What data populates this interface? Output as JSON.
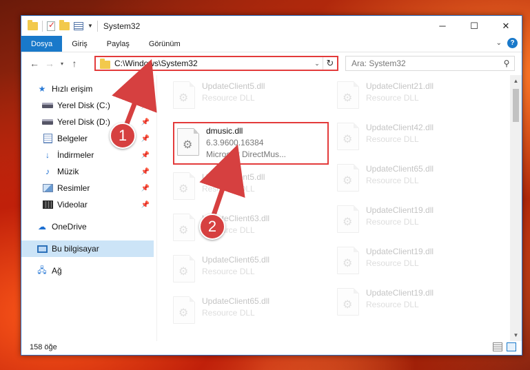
{
  "window": {
    "title": "System32",
    "controls": {
      "minimize": "─",
      "maximize": "☐",
      "close": "✕"
    }
  },
  "ribbon": {
    "tabs": [
      "Dosya",
      "Giriş",
      "Paylaş",
      "Görünüm"
    ],
    "help": "?"
  },
  "navigation": {
    "back": "←",
    "forward": "→",
    "recent": "▾",
    "up": "↑",
    "address": "C:\\Windows\\System32",
    "search_placeholder": "Ara: System32"
  },
  "sidebar": {
    "quick_access": "Hızlı erişim",
    "pinned": [
      {
        "label": "Yerel Disk (C:)",
        "icon": "drive-icon"
      },
      {
        "label": "Yerel Disk (D:)",
        "icon": "drive-icon"
      },
      {
        "label": "Belgeler",
        "icon": "documents-icon"
      },
      {
        "label": "İndirmeler",
        "icon": "downloads-icon"
      },
      {
        "label": "Müzik",
        "icon": "music-icon"
      },
      {
        "label": "Resimler",
        "icon": "pictures-icon"
      },
      {
        "label": "Videolar",
        "icon": "videos-icon"
      }
    ],
    "onedrive": "OneDrive",
    "this_pc": "Bu bilgisayar",
    "network": "Ağ"
  },
  "files": {
    "left_column": [
      {
        "name": "UpdateClient5.dll",
        "desc": "Resource DLL"
      },
      {
        "name": "dmusic.dll",
        "version": "6.3.9600.16384",
        "desc": "Microsoft DirectMus..."
      },
      {
        "name": "UpdateClient5.dll",
        "desc": "Resource DLL"
      },
      {
        "name": "UpdateClient63.dll",
        "desc": "Resource DLL"
      },
      {
        "name": "UpdateClient65.dll",
        "desc": "Resource DLL"
      },
      {
        "name": "UpdateClient65.dll",
        "desc": "Resource DLL"
      }
    ],
    "right_column": [
      {
        "name": "UpdateClient21.dll",
        "desc": "Resource DLL"
      },
      {
        "name": "UpdateClient42.dll",
        "desc": "Resource DLL"
      },
      {
        "name": "UpdateClient65.dll",
        "desc": "Resource DLL"
      },
      {
        "name": "UpdateClient19.dll",
        "desc": "Resource DLL"
      },
      {
        "name": "UpdateClient19.dll",
        "desc": "Resource DLL"
      },
      {
        "name": "UpdateClient19.dll",
        "desc": "Resource DLL"
      }
    ]
  },
  "status": {
    "count": "158 öğe"
  },
  "callouts": {
    "one": "1",
    "two": "2"
  },
  "colors": {
    "accent": "#1979ca",
    "highlight": "#e33a3a",
    "callout": "#d64040"
  }
}
